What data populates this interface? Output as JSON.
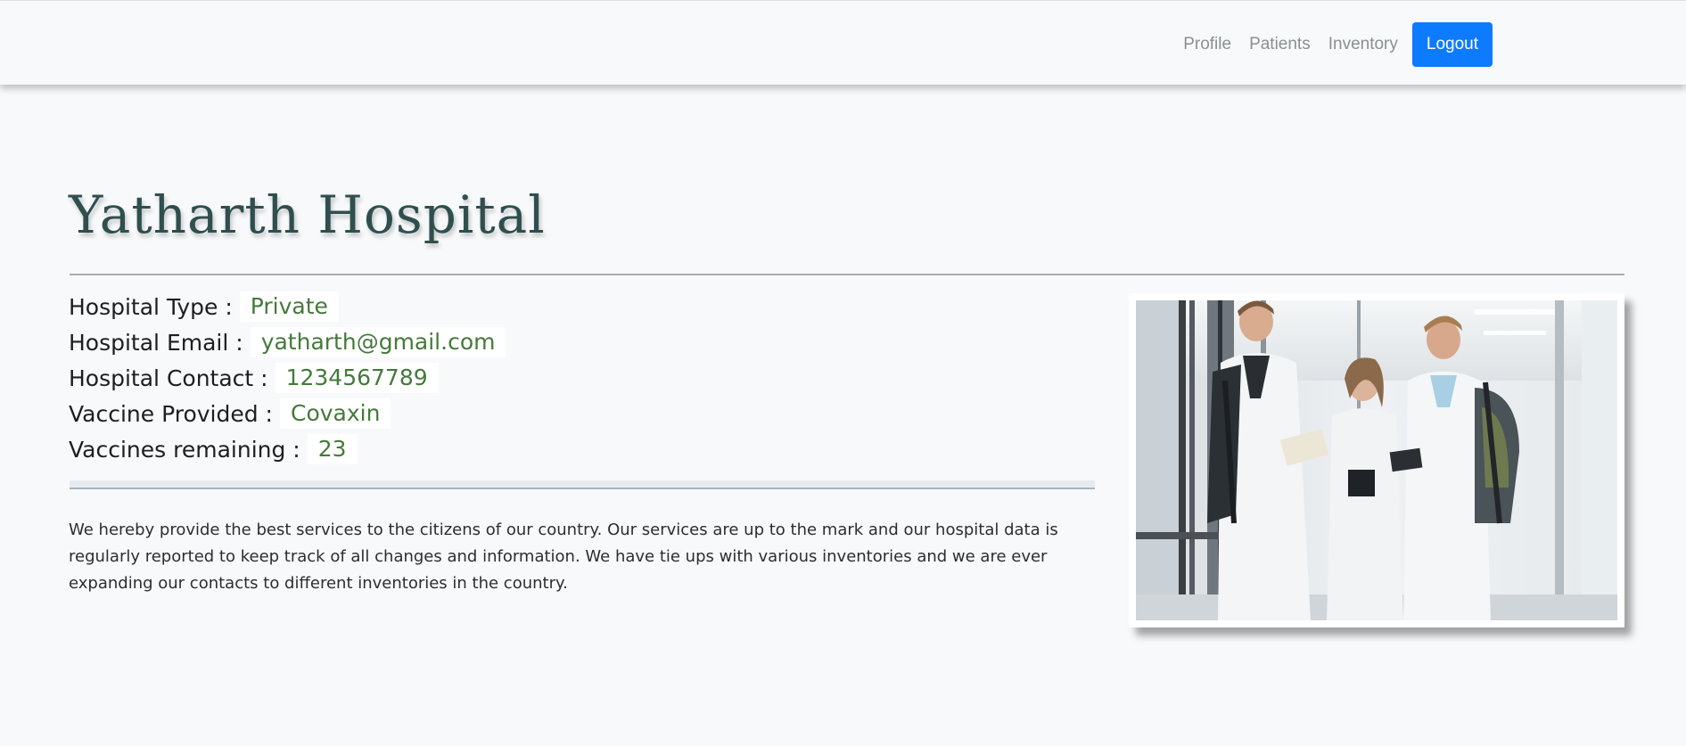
{
  "nav": {
    "links": [
      "Profile",
      "Patients",
      "Inventory"
    ],
    "logout_label": "Logout"
  },
  "hospital": {
    "name": "Yatharth Hospital",
    "fields": [
      {
        "label": "Hospital Type :",
        "value": "Private"
      },
      {
        "label": "Hospital Email :",
        "value": "yatharth@gmail.com"
      },
      {
        "label": "Hospital Contact :",
        "value": "1234567789"
      },
      {
        "label": "Vaccine Provided :",
        "value": "Covaxin"
      },
      {
        "label": "Vaccines remaining :",
        "value": "23"
      }
    ],
    "description": "We hereby provide the best services to the citizens of our country. Our services are up to the mark and our hospital data is regularly reported to keep track of all changes and information. We have tie ups with various inventories and we are ever expanding our contacts to different inventories in the country."
  },
  "colors": {
    "accent": "#0d7bff",
    "title": "#2f4f4f",
    "value": "#447a3a",
    "background": "#f8f9fb"
  }
}
